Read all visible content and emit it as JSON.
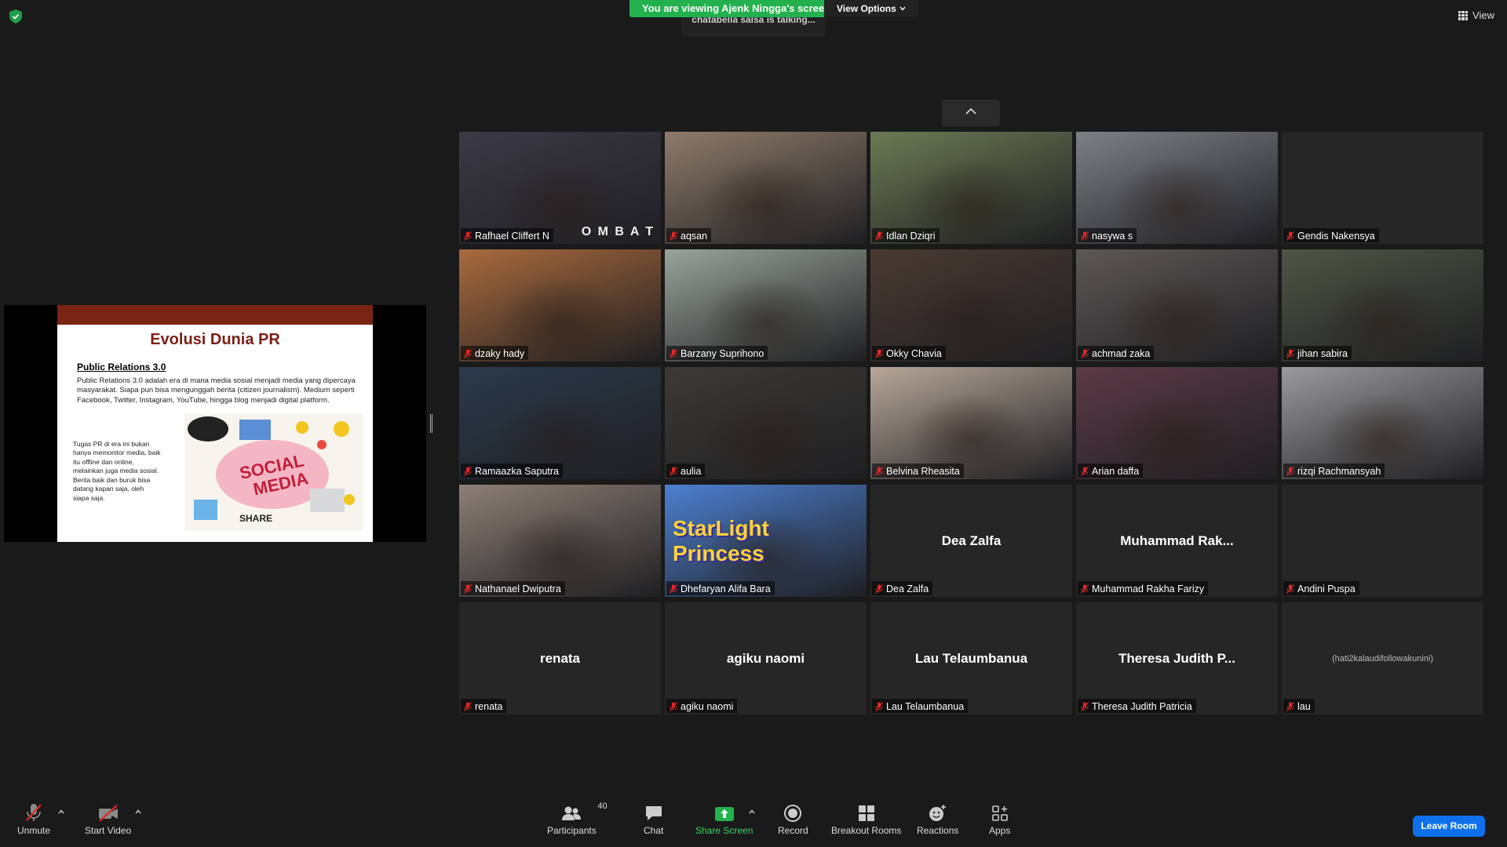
{
  "banner": {
    "viewing_text": "You are viewing Ajenk Ningga's screen",
    "options_label": "View Options",
    "talking_text": "chatabella salsa is talking..."
  },
  "view": {
    "label": "View"
  },
  "slide": {
    "title": "Evolusi Dunia PR",
    "subtitle": "Public Relations 3.0",
    "paragraph1": "Public Relations 3.0 adalah era di mana media sosial menjadi media yang dipercaya masyarakat. Siapa pun bisa mengunggah berita (citizen journalism). Medium seperti Facebook, Twitter, Instagram, YouTube, hingga blog menjadi digital platform.",
    "paragraph2": "Tugas PR di era ini bukan hanya memonitor media, baik itu offline dan online, melainkan juga media sosial. Berita baik dan buruk bisa datang kapan saja, oleh siapa saja.",
    "image_text_1": "SOCIAL",
    "image_text_2": "MEDIA",
    "image_text_3": "SHARE"
  },
  "participants": [
    {
      "name": "Rafhael Cliffert N",
      "center": "",
      "color": "#3b3a45",
      "watermark": "O M B A T"
    },
    {
      "name": "aqsan",
      "center": "",
      "color": "#8e7b6b",
      "watermark": ""
    },
    {
      "name": "Idlan Dziqri",
      "center": "",
      "color": "#6b7a54",
      "watermark": ""
    },
    {
      "name": "nasywa s",
      "center": "",
      "color": "#7d8087",
      "watermark": ""
    },
    {
      "name": "Gendis Nakensya",
      "center": "",
      "color": "#262626",
      "watermark": ""
    },
    {
      "name": "dzaky hady",
      "center": "",
      "color": "#a86a3d",
      "watermark": ""
    },
    {
      "name": "Barzany Suprihono",
      "center": "",
      "color": "#98a39a",
      "watermark": ""
    },
    {
      "name": "Okky Chavia",
      "center": "",
      "color": "#4a3a32",
      "watermark": ""
    },
    {
      "name": "achmad zaka",
      "center": "",
      "color": "#5d5857",
      "watermark": ""
    },
    {
      "name": "jihan sabira",
      "center": "",
      "color": "#4e5545",
      "watermark": ""
    },
    {
      "name": "Ramaazka Saputra",
      "center": "",
      "color": "#2c3a4c",
      "watermark": ""
    },
    {
      "name": "aulia",
      "center": "",
      "color": "#3c3a36",
      "watermark": ""
    },
    {
      "name": "Belvina Rheasita",
      "center": "",
      "color": "#b7a79a",
      "watermark": ""
    },
    {
      "name": "Arian daffa",
      "center": "",
      "color": "#5b3a46",
      "watermark": ""
    },
    {
      "name": "rizqi Rachmansyah",
      "center": "",
      "color": "#9a9a9c",
      "watermark": ""
    },
    {
      "name": "Nathanael Dwiputra",
      "center": "",
      "color": "#8d7f76",
      "watermark": ""
    },
    {
      "name": "Dhefaryan Alifa Bara",
      "center": "",
      "color": "#4d7fd0",
      "watermark": "StarLight Princess"
    },
    {
      "name": "Dea Zalfa",
      "center": "Dea Zalfa",
      "color": "#262626",
      "watermark": ""
    },
    {
      "name": "Muhammad Rakha Farizy",
      "center": "Muhammad  Rak...",
      "color": "#262626",
      "watermark": ""
    },
    {
      "name": "Andini Puspa",
      "center": "",
      "color": "#262626",
      "watermark": ""
    },
    {
      "name": "renata",
      "center": "renata",
      "color": "#262626",
      "watermark": ""
    },
    {
      "name": "agiku naomi",
      "center": "agiku naomi",
      "color": "#262626",
      "watermark": ""
    },
    {
      "name": "Lau Telaumbanua",
      "center": "Lau Telaumbanua",
      "color": "#262626",
      "watermark": ""
    },
    {
      "name": "Theresa Judith Patricia",
      "center": "Theresa Judith P...",
      "color": "#262626",
      "watermark": ""
    },
    {
      "name": "lau",
      "center": "(hati2kalaudifollowakunini)",
      "color": "#262626",
      "watermark": ""
    }
  ],
  "toolbar": {
    "unmute": "Unmute",
    "start_video": "Start Video",
    "participants": "Participants",
    "participants_count": "40",
    "chat": "Chat",
    "share_screen": "Share Screen",
    "record": "Record",
    "breakout_rooms": "Breakout Rooms",
    "reactions": "Reactions",
    "apps": "Apps",
    "leave_room": "Leave Room"
  },
  "colors": {
    "accent_green": "#23b14d",
    "leave_blue": "#0e71eb",
    "mic_red": "#e02828"
  }
}
